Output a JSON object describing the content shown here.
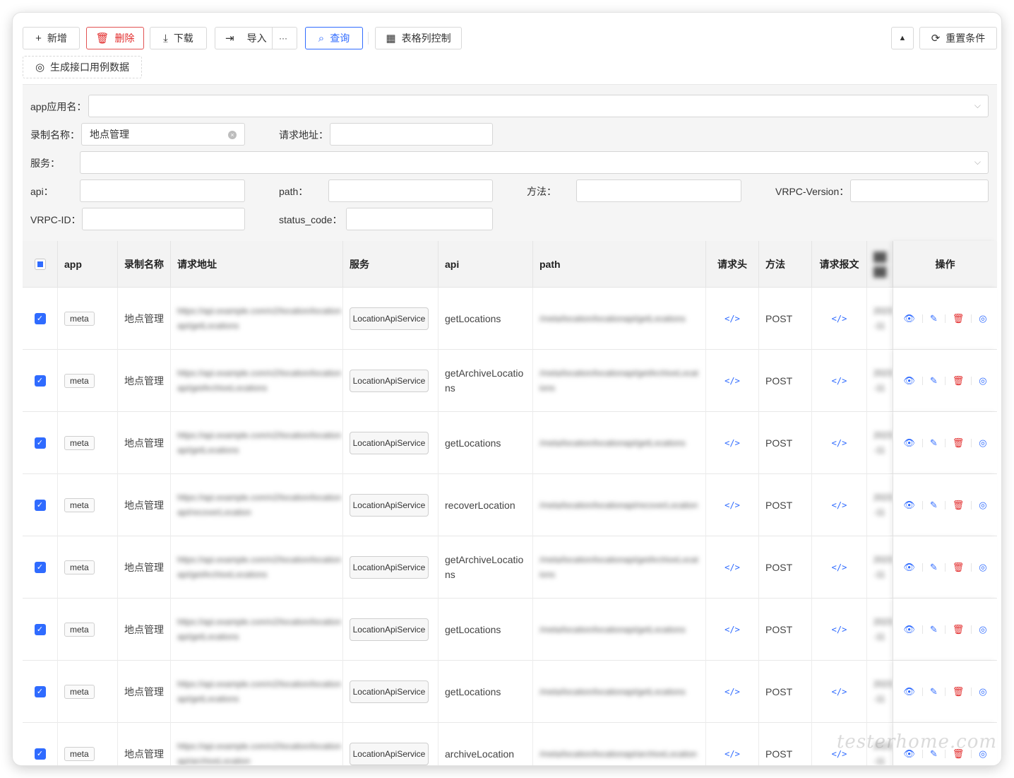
{
  "toolbar": {
    "add": "新增",
    "delete": "删除",
    "download": "下载",
    "import": "导入",
    "more": "···",
    "query": "查询",
    "column_control": "表格列控制",
    "collapse": "▲",
    "reset": "重置条件",
    "generate": "生成接口用例数据"
  },
  "filters": {
    "app_label": "app应用名：",
    "app_value": "",
    "record_label": "录制名称：",
    "record_value": "地点管理",
    "url_label": "请求地址：",
    "url_value": "",
    "service_label": "服务：",
    "service_value": "",
    "api_label": "api：",
    "api_value": "",
    "path_label": "path：",
    "path_value": "",
    "method_label": "方法：",
    "method_value": "",
    "vrpc_version_label": "VRPC-Version：",
    "vrpc_version_value": "",
    "vrpc_id_label": "VRPC-ID：",
    "vrpc_id_value": "",
    "status_code_label": "status_code：",
    "status_code_value": ""
  },
  "table": {
    "headers": {
      "app": "app",
      "record": "录制名称",
      "url": "请求地址",
      "service": "服务",
      "api": "api",
      "path": "path",
      "req_header": "请求头",
      "method": "方法",
      "req_body": "请求报文",
      "actions": "操作"
    },
    "rows": [
      {
        "app": "meta",
        "record": "地点管理",
        "url": "https://api.example.com/v2/location/locationapi/getLocations",
        "service": "LocationApiService",
        "api": "getLocations",
        "path": "/meta/location/locationapi/getLocations",
        "req_header": "</>",
        "method": "POST",
        "req_body": "</>",
        "extra": "2023-11"
      },
      {
        "app": "meta",
        "record": "地点管理",
        "url": "https://api.example.com/v2/location/locationapi/getArchiveLocations",
        "service": "LocationApiService",
        "api": "getArchiveLocations",
        "path": "/meta/location/locationapi/getArchiveLocations",
        "req_header": "</>",
        "method": "POST",
        "req_body": "</>",
        "extra": "2023-11"
      },
      {
        "app": "meta",
        "record": "地点管理",
        "url": "https://api.example.com/v2/location/locationapi/getLocations",
        "service": "LocationApiService",
        "api": "getLocations",
        "path": "/meta/location/locationapi/getLocations",
        "req_header": "</>",
        "method": "POST",
        "req_body": "</>",
        "extra": "2023-11"
      },
      {
        "app": "meta",
        "record": "地点管理",
        "url": "https://api.example.com/v2/location/locationapi/recoverLocation",
        "service": "LocationApiService",
        "api": "recoverLocation",
        "path": "/meta/location/locationapi/recoverLocation",
        "req_header": "</>",
        "method": "POST",
        "req_body": "</>",
        "extra": "2023-11"
      },
      {
        "app": "meta",
        "record": "地点管理",
        "url": "https://api.example.com/v2/location/locationapi/getArchiveLocations",
        "service": "LocationApiService",
        "api": "getArchiveLocations",
        "path": "/meta/location/locationapi/getArchiveLocations",
        "req_header": "</>",
        "method": "POST",
        "req_body": "</>",
        "extra": "2023-11"
      },
      {
        "app": "meta",
        "record": "地点管理",
        "url": "https://api.example.com/v2/location/locationapi/getLocations",
        "service": "LocationApiService",
        "api": "getLocations",
        "path": "/meta/location/locationapi/getLocations",
        "req_header": "</>",
        "method": "POST",
        "req_body": "</>",
        "extra": "2023-11"
      },
      {
        "app": "meta",
        "record": "地点管理",
        "url": "https://api.example.com/v2/location/locationapi/getLocations",
        "service": "LocationApiService",
        "api": "getLocations",
        "path": "/meta/location/locationapi/getLocations",
        "req_header": "</>",
        "method": "POST",
        "req_body": "</>",
        "extra": "2023-11"
      },
      {
        "app": "meta",
        "record": "地点管理",
        "url": "https://api.example.com/v2/location/locationapi/archiveLocation",
        "service": "LocationApiService",
        "api": "archiveLocation",
        "path": "/meta/location/locationapi/archiveLocation",
        "req_header": "</>",
        "method": "POST",
        "req_body": "</>",
        "extra": "2023-11"
      }
    ]
  },
  "watermark": "testerhome.com",
  "colors": {
    "primary": "#2f6bff",
    "danger": "#e22b2b"
  }
}
